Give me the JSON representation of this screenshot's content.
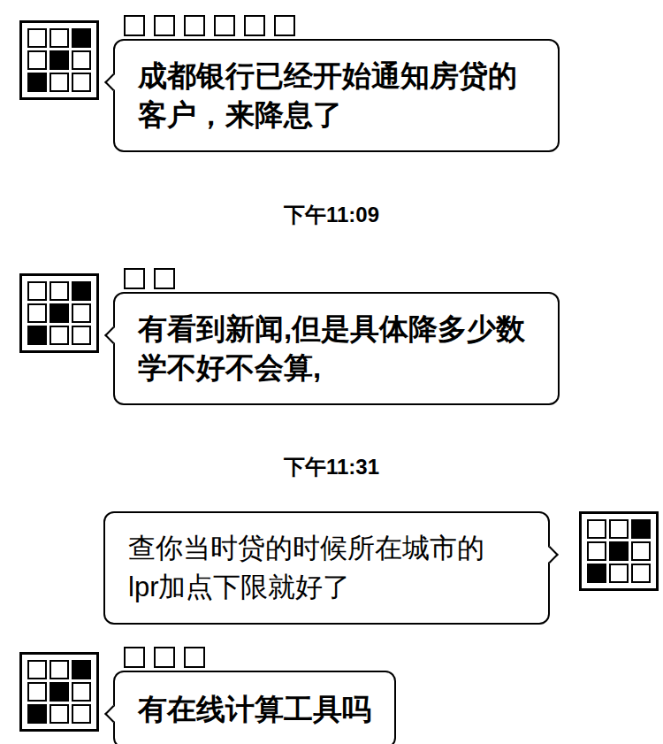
{
  "messages": [
    {
      "kind": "message",
      "side": "left",
      "nickname_blocks": 6,
      "lines": [
        "成都银行已经开始通知房贷的",
        "客户，来降息了"
      ]
    },
    {
      "kind": "time",
      "text": "下午11:09"
    },
    {
      "kind": "message",
      "side": "left",
      "nickname_blocks": 2,
      "lines": [
        "有看到新闻,但是具体降多少数",
        "学不好不会算,"
      ]
    },
    {
      "kind": "time",
      "text": "下午11:31"
    },
    {
      "kind": "message",
      "side": "right",
      "nickname_blocks": 0,
      "lines": [
        "查你当时贷的时候所在城市的",
        "lpr加点下限就好了"
      ]
    },
    {
      "kind": "message",
      "side": "left",
      "nickname_blocks": 3,
      "lines": [
        "有在线计算工具吗"
      ]
    }
  ]
}
